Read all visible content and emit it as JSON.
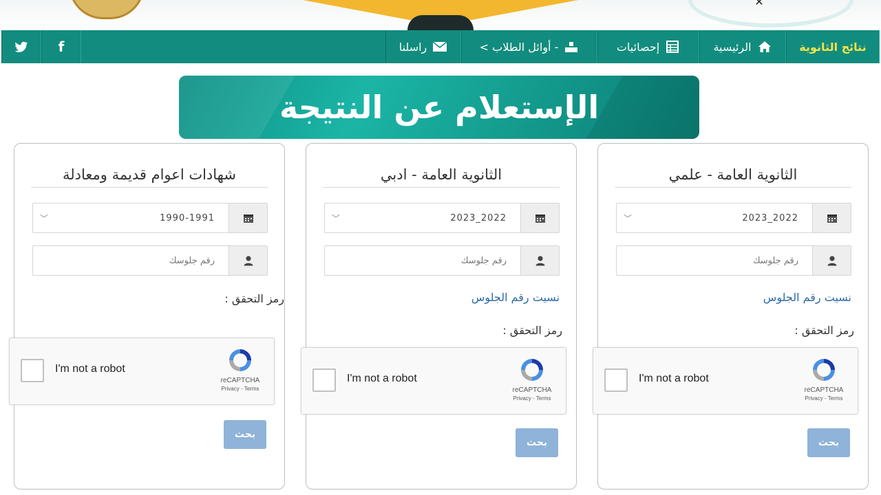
{
  "nav": {
    "brand": "نتائج الثانوية",
    "home": "الرئيسية",
    "stats": "إحصائيات",
    "top_students": "< أوائل الطلاب -",
    "contact": "راسلنا",
    "facebook": "f",
    "twitter": "t"
  },
  "title": "الإستعلام عن النتيجة",
  "cards": [
    {
      "title": "الثانوية العامة - علمي",
      "year": "2023_2022",
      "seat_placeholder": "رقم جلوسك",
      "forgot": "نسيت رقم الجلوس",
      "verify": "رمز التحقق :",
      "captcha_text": "I'm not a robot",
      "captcha_brand": "reCAPTCHA",
      "captcha_terms": "Privacy - Terms",
      "search": "بحث"
    },
    {
      "title": "الثانوية العامة - ادبي",
      "year": "2023_2022",
      "seat_placeholder": "رقم جلوسك",
      "forgot": "نسيت رقم الجلوس",
      "verify": "رمز التحقق :",
      "captcha_text": "I'm not a robot",
      "captcha_brand": "reCAPTCHA",
      "captcha_terms": "Privacy - Terms",
      "search": "بحث"
    },
    {
      "title": "شهادات اعوام قديمة ومعادلة",
      "year": "1990-1991",
      "seat_placeholder": "رقم جلوسك",
      "verify": "رمز التحقق :",
      "captcha_text": "I'm not a robot",
      "captcha_brand": "reCAPTCHA",
      "captcha_terms": "Privacy - Terms",
      "search": "بحث"
    }
  ],
  "colors": {
    "nav_bg": "#128c7e",
    "brand_text": "#f4e44a",
    "link": "#2a6aa6",
    "button": "#8fb3d9"
  }
}
